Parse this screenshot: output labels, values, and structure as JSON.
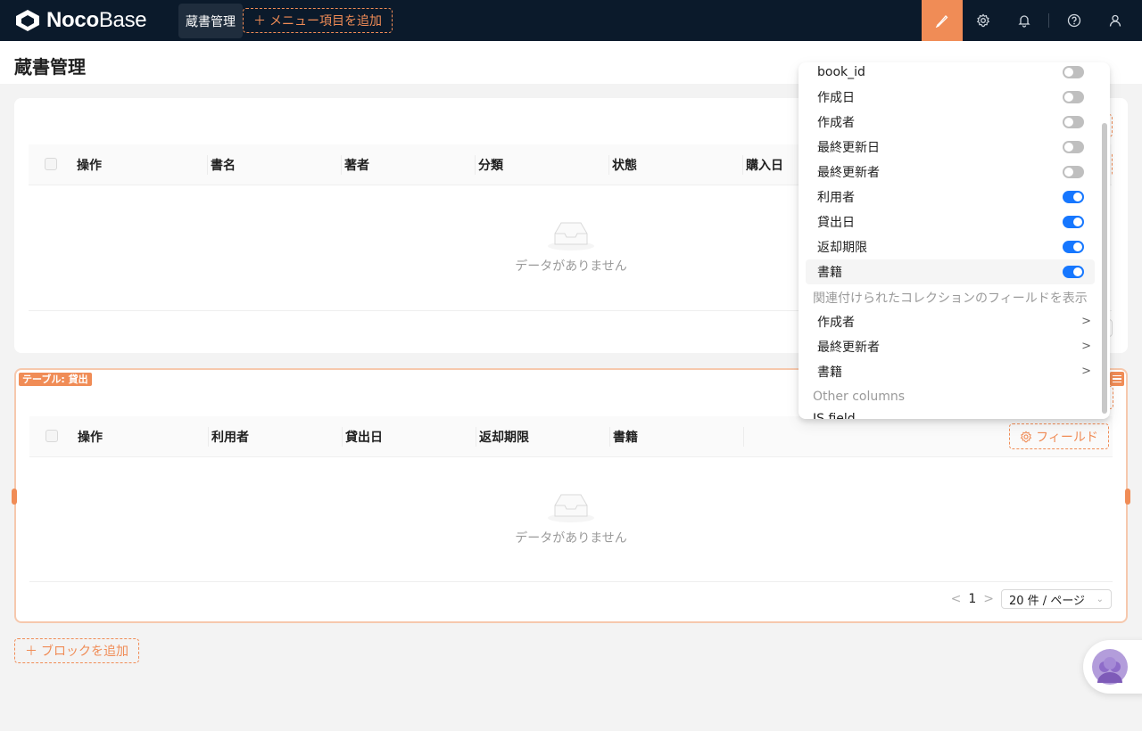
{
  "app": {
    "logo_bold": "Noco",
    "logo_light": "Base",
    "active_menu": "蔵書管理",
    "add_menu_item": "メニュー項目を追加"
  },
  "page": {
    "title": "蔵書管理"
  },
  "table1": {
    "columns": [
      "操作",
      "書名",
      "著者",
      "分類",
      "状態",
      "購入日"
    ],
    "empty_text": "データがありません"
  },
  "table2": {
    "tag": "テーブル: 貸出",
    "columns": [
      "操作",
      "利用者",
      "貸出日",
      "返却期限",
      "書籍"
    ],
    "fields_button": "フィールド",
    "empty_text": "データがありません",
    "pagination": {
      "current_page": "1",
      "page_size": "20 件 / ページ"
    }
  },
  "add_block": "ブロックを追加",
  "field_dropdown": {
    "items": [
      {
        "label": "book_id",
        "enabled": false
      },
      {
        "label": "作成日",
        "enabled": false
      },
      {
        "label": "作成者",
        "enabled": false
      },
      {
        "label": "最終更新日",
        "enabled": false
      },
      {
        "label": "最終更新者",
        "enabled": false
      },
      {
        "label": "利用者",
        "enabled": true
      },
      {
        "label": "貸出日",
        "enabled": true
      },
      {
        "label": "返却期限",
        "enabled": true
      },
      {
        "label": "書籍",
        "enabled": true
      }
    ],
    "related_group_label": "関連付けられたコレクションのフィールドを表示",
    "related_items": [
      "作成者",
      "最終更新者",
      "書籍"
    ],
    "other_group_label": "Other columns",
    "partial_item": "JS field"
  },
  "colors": {
    "accent": "#f08c56",
    "navbar": "#0b1a2b",
    "toggle_on": "#1677ff"
  }
}
